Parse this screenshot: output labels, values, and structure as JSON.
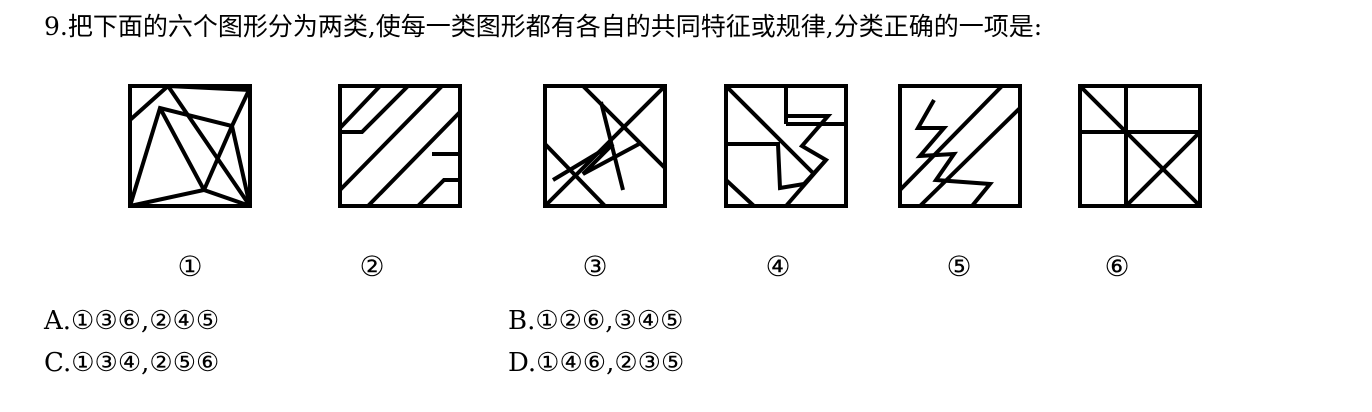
{
  "question": {
    "text": "9.把下面的六个图形分为两类,使每一类图形都有各自的共同特征或规律,分类正确的一项是:"
  },
  "figures": [
    {
      "label": "①"
    },
    {
      "label": "②"
    },
    {
      "label": "③"
    },
    {
      "label": "④"
    },
    {
      "label": "⑤"
    },
    {
      "label": "⑥"
    }
  ],
  "options": {
    "A": "A.①③⑥,②④⑤",
    "B": "B.①②⑥,③④⑤",
    "C": "C.①③④,②⑤⑥",
    "D": "D.①④⑥,②③⑤"
  }
}
